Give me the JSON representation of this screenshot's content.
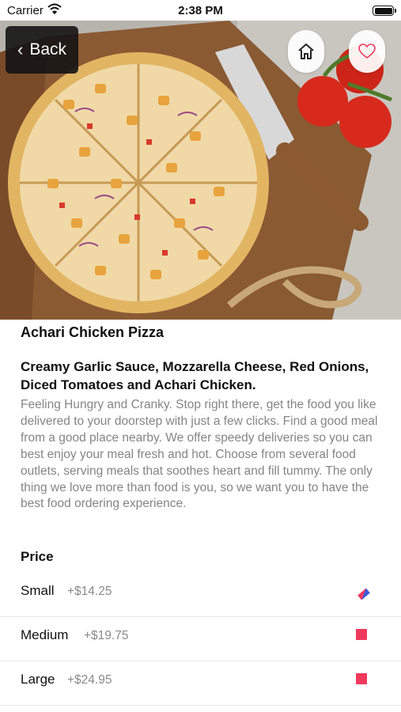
{
  "status_bar": {
    "carrier": "Carrier",
    "time": "2:38 PM"
  },
  "nav": {
    "back_label": "Back",
    "back_icon": "chevron-left-icon",
    "home_icon": "home-icon",
    "favorite_icon": "heart-icon"
  },
  "product": {
    "title": "Achari Chicken Pizza",
    "ingredients": "Creamy Garlic Sauce, Mozzarella Cheese, Red Onions, Diced Tomatoes and Achari Chicken.",
    "description": "Feeling Hungry and Cranky. Stop right there, get the food you like delivered to your doorstep with just a few clicks. Find a good meal from a good place nearby. We offer speedy deliveries so you can best enjoy your meal fresh and hot. Choose from several food outlets, serving meals that soothes heart and fill tummy. The only thing we love more than food is you, so we want you to have the best food ordering experience."
  },
  "price_section": {
    "heading": "Price",
    "options": [
      {
        "size": "Small",
        "price": "+$14.25",
        "selected": true
      },
      {
        "size": "Medium",
        "price": "+$19.75",
        "selected": false
      },
      {
        "size": "Large",
        "price": "+$24.95",
        "selected": false
      }
    ]
  },
  "colors": {
    "accent": "#ef3a5d",
    "secondary": "#3b5bdb",
    "muted_text": "#858585",
    "divider": "#e7e7ec"
  }
}
